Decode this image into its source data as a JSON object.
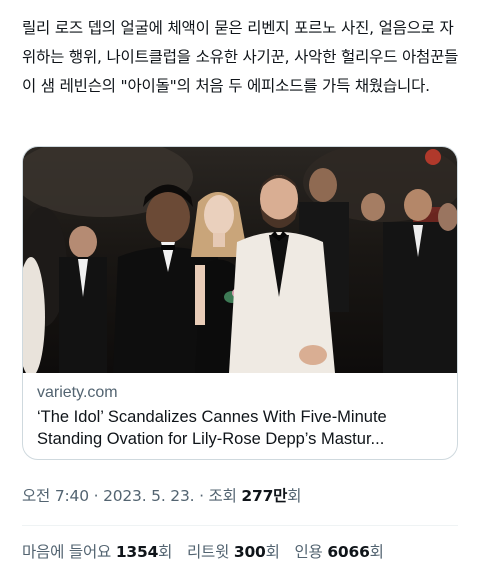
{
  "tweet": {
    "text": "릴리 로즈 뎁의 얼굴에 체액이 묻은 리벤지 포르노 사진, 얼음으로 자위하는 행위, 나이트클럽을 소유한 사기꾼, 사악한 헐리우드 아첨꾼들이 샘 레빈슨의 \"아이돌\"의 처음 두 에피소드를 가득 채웠습니다."
  },
  "link_card": {
    "domain": "variety.com",
    "title": "‘The Idol’ Scandalizes Cannes With Five-Minute Standing Ovation for Lily-Rose Depp’s Mastur..."
  },
  "meta": {
    "time": "오전 7:40",
    "sep1": "·",
    "date": "2023. 5. 23.",
    "sep2": "·",
    "views_label": "조회",
    "views_count": "277만",
    "views_suffix": "회"
  },
  "stats": {
    "likes_label": "마음에 들어요",
    "likes_count": "1354",
    "likes_suffix": "회",
    "retweets_label": "리트윗",
    "retweets_count": "300",
    "retweets_suffix": "회",
    "quotes_label": "인용",
    "quotes_count": "6066",
    "quotes_suffix": "회"
  },
  "colors": {
    "text_primary": "#0f1419",
    "text_secondary": "#536471",
    "border": "#cfd9de"
  }
}
